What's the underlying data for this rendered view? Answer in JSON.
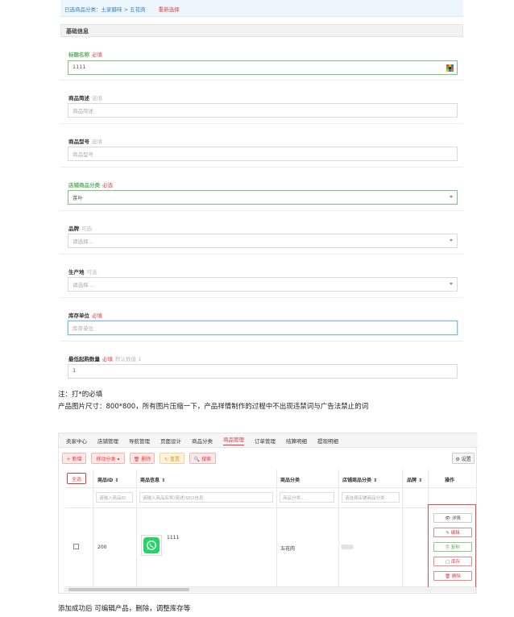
{
  "category_bar": {
    "label": "已选商品分类：土家腊味 > 五花肉",
    "reselect": "重新选择"
  },
  "section_title": "基础信息",
  "fields": {
    "title": {
      "label": "标题名称",
      "flag": "必填",
      "value": "1111"
    },
    "desc": {
      "label": "商品简述",
      "flag": "选填",
      "placeholder": "商品简述"
    },
    "model": {
      "label": "商品型号",
      "flag": "选填",
      "placeholder": "商品型号"
    },
    "shop_cat": {
      "label": "店铺商品分类",
      "flag": "必选",
      "value": "茶叶"
    },
    "brand": {
      "label": "品牌",
      "flag": "可选",
      "placeholder": "请选择..."
    },
    "origin": {
      "label": "生产地",
      "flag": "可选",
      "placeholder": "请选择..."
    },
    "unit": {
      "label": "库存单位",
      "flag": "必填",
      "placeholder": "库存单位"
    },
    "min_qty": {
      "label": "最低起购数量",
      "flag": "必填",
      "hint": "默认数值 1",
      "value": "1"
    }
  },
  "notes": {
    "line1": "注：打*的必填",
    "line2": "产品图片尺寸：800*800，所有图片压缩一下，产品祥情制作的过程中不出现违禁词与广告法禁止的词",
    "bottom": "添加成功后   可编辑产品，删除，调整库存等"
  },
  "shop": {
    "nav": [
      "卖家中心",
      "店铺管理",
      "导航管理",
      "页面设计",
      "商品分类",
      "商品管理",
      "订单管理",
      "结算明细",
      "提现明细"
    ],
    "active_nav": "商品管理",
    "toolbar": {
      "add": "+ 新增",
      "move": "移动分类 ▾",
      "delete": "🗑 删除",
      "reset": "↻ 重置",
      "search": "🔍 搜索",
      "settings": "⚙ 设置"
    },
    "table": {
      "all_btn": "全选",
      "headers": [
        "商品ID ⇕",
        "商品信息 ⇕",
        "商品分类",
        "店铺商品分类 ⇕",
        "品牌 ⇕",
        "操作"
      ],
      "filter_placeholders": [
        "请输入商品ID",
        "请输入商品名称/简述/SEO信息",
        "商品分类...",
        "请选择店铺商品分类"
      ],
      "row": {
        "id": "200",
        "name": "1111",
        "category": "五花肉"
      },
      "actions": [
        "👁 详情",
        "✎ 编辑",
        "⎘ 复制",
        "▢ 库存",
        "🗑 删除"
      ]
    }
  },
  "colors": {
    "accent": "#e4393c",
    "green": "#58b35b",
    "blue_link": "#2c7fc8",
    "whatsapp": "#25d366"
  }
}
